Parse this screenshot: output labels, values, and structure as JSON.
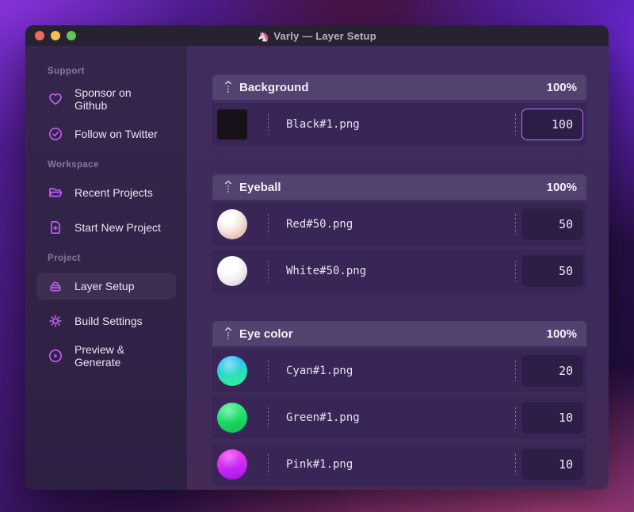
{
  "window": {
    "title": "Varly — Layer Setup",
    "app_icon": "🦄"
  },
  "sidebar": {
    "sections": [
      {
        "label": "Support",
        "items": [
          {
            "icon": "heart-icon",
            "label": "Sponsor on Github"
          },
          {
            "icon": "badge-check-icon",
            "label": "Follow on Twitter"
          }
        ]
      },
      {
        "label": "Workspace",
        "items": [
          {
            "icon": "folder-open-icon",
            "label": "Recent Projects"
          },
          {
            "icon": "file-plus-icon",
            "label": "Start New Project"
          }
        ]
      },
      {
        "label": "Project",
        "items": [
          {
            "icon": "layers-icon",
            "label": "Layer Setup",
            "selected": true
          },
          {
            "icon": "gear-icon",
            "label": "Build Settings"
          },
          {
            "icon": "play-circle-icon",
            "label": "Preview & Generate"
          }
        ]
      }
    ]
  },
  "main": {
    "groups": [
      {
        "name": "Background",
        "percent": "100%",
        "layers": [
          {
            "file": "Black#1.png",
            "value": "100",
            "thumb": "black-square",
            "focused": true
          }
        ]
      },
      {
        "name": "Eyeball",
        "percent": "100%",
        "layers": [
          {
            "file": "Red#50.png",
            "value": "50",
            "thumb": "red-sphere"
          },
          {
            "file": "White#50.png",
            "value": "50",
            "thumb": "white-sphere"
          }
        ]
      },
      {
        "name": "Eye color",
        "percent": "100%",
        "layers": [
          {
            "file": "Cyan#1.png",
            "value": "20",
            "thumb": "cyan-sphere"
          },
          {
            "file": "Green#1.png",
            "value": "10",
            "thumb": "green-sphere"
          },
          {
            "file": "Pink#1.png",
            "value": "10",
            "thumb": "pink-sphere"
          }
        ]
      }
    ]
  },
  "colors": {
    "accent_icon": "#bd5ef2",
    "focus_border": "#a97af2",
    "traffic_close": "#ed6a5e",
    "traffic_minimize": "#f5bf4f",
    "traffic_zoom": "#61c554",
    "group_header_bg": "#53416f",
    "row_bg": "#392657",
    "sidebar_bg": "#35264b",
    "main_bg": "#402c5e",
    "titlebar_bg": "#262230"
  }
}
